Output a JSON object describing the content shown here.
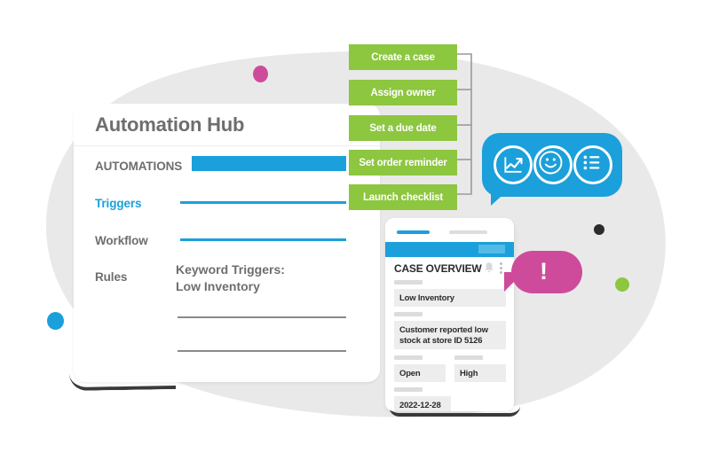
{
  "illustration": {
    "title": "Automation Hub case management illustration"
  },
  "colors": {
    "green": "#8DC63F",
    "blue": "#1BA0DB",
    "pink": "#CE4B9B",
    "gray_blob": "#E9E9E9",
    "text_gray": "#6D6E71",
    "dark": "#2B2B2B"
  },
  "hub_card": {
    "title": "Automation Hub",
    "rows": [
      {
        "label": "AUTOMATIONS",
        "accent": false,
        "field": "bar"
      },
      {
        "label": "Triggers",
        "accent": true,
        "field": "line"
      },
      {
        "label": "Workflow",
        "accent": false,
        "field": "line"
      },
      {
        "label": "Rules",
        "accent": false,
        "field": "text"
      }
    ],
    "rule_value_line1": "Keyword Triggers:",
    "rule_value_line2": "Low Inventory"
  },
  "actions": {
    "items": [
      {
        "label": "Create a case"
      },
      {
        "label": "Assign owner"
      },
      {
        "label": "Set a due date"
      },
      {
        "label": "Set order reminder"
      },
      {
        "label": "Launch checklist"
      }
    ]
  },
  "chat_bubble": {
    "icons": [
      {
        "name": "line-chart-icon"
      },
      {
        "name": "smiley-face-icon"
      },
      {
        "name": "bullet-list-icon"
      }
    ]
  },
  "alert_bubble": {
    "mark": "!"
  },
  "phone_card": {
    "header_title": "CASE OVERVIEW",
    "bell_icon": "bell-icon",
    "menu_icon": "kebab-menu-icon",
    "fields": [
      {
        "name": "subject",
        "value": "Low Inventory"
      },
      {
        "name": "description",
        "value": "Customer reported low\nstock at store ID 5126"
      },
      {
        "name": "status",
        "value": "Open"
      },
      {
        "name": "priority",
        "value": "High"
      },
      {
        "name": "date",
        "value": "2022-12-28"
      }
    ]
  },
  "dots": [
    {
      "name": "pink-dot",
      "color": "#CE4B9B"
    },
    {
      "name": "blue-dot",
      "color": "#1BA0DB"
    },
    {
      "name": "dark-dot",
      "color": "#2B2B2B"
    },
    {
      "name": "green-dot",
      "color": "#8DC63F"
    }
  ]
}
